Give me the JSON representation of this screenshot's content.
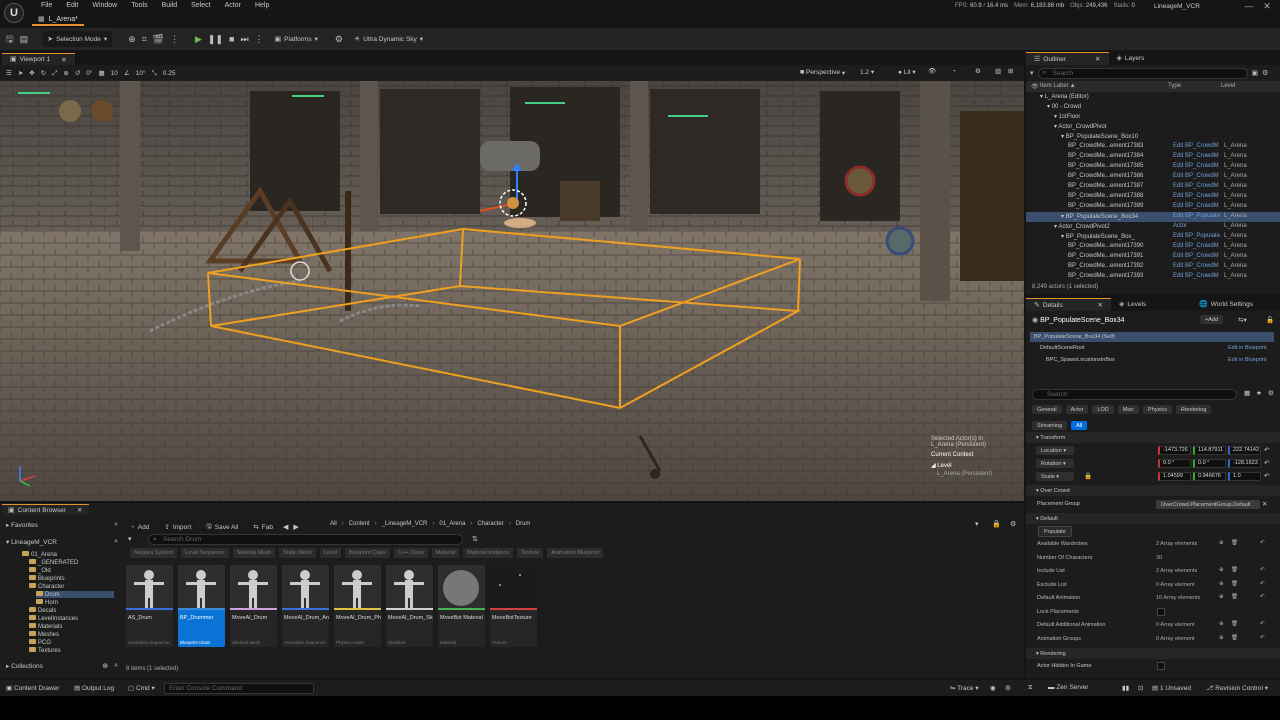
{
  "app": {
    "logo": "U",
    "doc_tab": "L_Arena*",
    "menu": [
      "File",
      "Edit",
      "Window",
      "Tools",
      "Build",
      "Select",
      "Actor",
      "Help"
    ],
    "stats": {
      "fps_label": "FPS",
      "fps": "60.9",
      "ms": "16.4 ms",
      "mem_label": "Mem",
      "mem": "6,183.88 mb",
      "objs_label": "Objs",
      "objs": "249,436",
      "stalls_label": "Stalls",
      "stalls": "0"
    },
    "project": "LineageM_VCR"
  },
  "toolbar": {
    "selection_mode": "Selection Mode",
    "platforms": "Platforms",
    "sky": "Ultra Dynamic Sky"
  },
  "viewport": {
    "tab": "Viewport 1",
    "tools": {
      "rot": "0°",
      "snap1": "10",
      "snap2": "10°",
      "scale": "0.25",
      "perspective": "Perspective",
      "speed": "1.2",
      "lit": "Lit"
    },
    "selected_label": "Selected Actor(s) in",
    "selected_level": "L_Arena (Persistent)",
    "context_label": "Current Context",
    "context_level_label": "Level",
    "context_level": "L_Arena (Persistent)"
  },
  "outliner": {
    "tabs": [
      "Outliner",
      "Layers"
    ],
    "search_placeholder": "Search",
    "columns": [
      "Item Label ▲",
      "Type",
      "Level"
    ],
    "rows": [
      {
        "label": "L_Arena (Editor)",
        "type": "",
        "level": "",
        "indent": 0
      },
      {
        "label": "00 - Crowd",
        "type": "",
        "level": "",
        "indent": 1
      },
      {
        "label": "1stFloor",
        "type": "",
        "level": "",
        "indent": 2
      },
      {
        "label": "Actor_CrowdPivot",
        "type": "",
        "level": "",
        "indent": 2
      },
      {
        "label": "BP_PopulateScene_Box10",
        "type": "",
        "level": "",
        "indent": 3
      },
      {
        "label": "BP_CrowdMe...ement17383",
        "type": "Edit BP_CrowdM",
        "level": "L_Arena",
        "indent": 4
      },
      {
        "label": "BP_CrowdMe...ement17384",
        "type": "Edit BP_CrowdM",
        "level": "L_Arena",
        "indent": 4
      },
      {
        "label": "BP_CrowdMe...ement17385",
        "type": "Edit BP_CrowdM",
        "level": "L_Arena",
        "indent": 4
      },
      {
        "label": "BP_CrowdMe...ement17386",
        "type": "Edit BP_CrowdM",
        "level": "L_Arena",
        "indent": 4
      },
      {
        "label": "BP_CrowdMe...ement17387",
        "type": "Edit BP_CrowdM",
        "level": "L_Arena",
        "indent": 4
      },
      {
        "label": "BP_CrowdMe...ement17388",
        "type": "Edit BP_CrowdM",
        "level": "L_Arena",
        "indent": 4
      },
      {
        "label": "BP_CrowdMe...ement17389",
        "type": "Edit BP_CrowdM",
        "level": "L_Arena",
        "indent": 4
      },
      {
        "label": "BP_PopulateScene_Box34",
        "type": "Edit BP_Populate",
        "level": "L_Arena",
        "indent": 3
      },
      {
        "label": "Actor_CrowdPivot2",
        "type": "Actor",
        "level": "L_Arena",
        "indent": 2
      },
      {
        "label": "BP_PopulateScene_Box_",
        "type": "Edit BP_Populate",
        "level": "L_Arena",
        "indent": 3
      },
      {
        "label": "BP_CrowdMe...ement17390",
        "type": "Edit BP_CrowdM",
        "level": "L_Arena",
        "indent": 4
      },
      {
        "label": "BP_CrowdMe...ement17391",
        "type": "Edit BP_CrowdM",
        "level": "L_Arena",
        "indent": 4
      },
      {
        "label": "BP_CrowdMe...ement17392",
        "type": "Edit BP_CrowdM",
        "level": "L_Arena",
        "indent": 4
      },
      {
        "label": "BP_CrowdMe...ement17393",
        "type": "Edit BP_CrowdM",
        "level": "L_Arena",
        "indent": 4
      }
    ],
    "footer": "8,249 actors (1 selected)"
  },
  "details": {
    "tabs": [
      "Details",
      "Levels",
      "World Settings"
    ],
    "actor_name": "BP_PopulateScene_Box34",
    "add_label": "+Add",
    "components": [
      {
        "label": "BP_PopulateScene_Box34 (Self)",
        "link": ""
      },
      {
        "label": "DefaultSceneRoot",
        "link": "Edit in Blueprint"
      },
      {
        "label": "BPC_SpawnLocationsInBox",
        "link": "Edit in Blueprint"
      }
    ],
    "search_placeholder": "Search",
    "filters": [
      "General",
      "Actor",
      "LOD",
      "Misc",
      "Physics",
      "Rendering",
      "Streaming",
      "All"
    ],
    "transform_header": "Transform",
    "location_label": "Location",
    "location": [
      "-1473.726",
      "114.87911",
      "222.74142"
    ],
    "rotation_label": "Rotation",
    "rotation": [
      "0.0 °",
      "0.0 °",
      "-128.1623"
    ],
    "scale_label": "Scale",
    "scale": [
      "1.04599",
      "0.946676",
      "1.0"
    ],
    "overcrowd_header": "Over Crowd",
    "placement_label": "Placement Group",
    "placement_value": "OverCrowd.PlacementGroup.Default",
    "default_header": "Default",
    "populate_button": "Populate",
    "props": [
      {
        "label": "Available Wardrobes",
        "value": "2 Array elements"
      },
      {
        "label": "Number Of Characters",
        "value": "30"
      },
      {
        "label": "Include List",
        "value": "2 Array elements"
      },
      {
        "label": "Exclude List",
        "value": "0 Array element"
      },
      {
        "label": "Default Animation",
        "value": "10 Array elements"
      },
      {
        "label": "Lock Placements",
        "value": ""
      },
      {
        "label": "Default Additional Animation",
        "value": "0 Array element"
      },
      {
        "label": "Animation Groups",
        "value": "0 Array element"
      }
    ],
    "rendering_header": "Rendering",
    "rendering_prop": "Actor Hidden In Game"
  },
  "content_browser": {
    "tab": "Content Browser",
    "add": "Add",
    "import": "Import",
    "save_all": "Save All",
    "fab": "Fab",
    "breadcrumb": [
      "All",
      "Content",
      "_LineageM_VCR",
      "01_Arena",
      "Character",
      "Drum"
    ],
    "search_placeholder": "Search Drum",
    "favorites": "Favorites",
    "project_root": "LineageM_VCR",
    "tree": [
      {
        "label": "01_Arena",
        "indent": 0
      },
      {
        "label": "_GENERATED",
        "indent": 1
      },
      {
        "label": "_Old",
        "indent": 1
      },
      {
        "label": "Blueprints",
        "indent": 1
      },
      {
        "label": "Character",
        "indent": 1
      },
      {
        "label": "Drum",
        "indent": 2
      },
      {
        "label": "Horn",
        "indent": 2
      },
      {
        "label": "Decals",
        "indent": 1
      },
      {
        "label": "LevelInstances",
        "indent": 1
      },
      {
        "label": "Materials",
        "indent": 1
      },
      {
        "label": "Meshes",
        "indent": 1
      },
      {
        "label": "PCG",
        "indent": 1
      },
      {
        "label": "Textures",
        "indent": 1
      }
    ],
    "collections": "Collections",
    "filter_chips": [
      "Niagara System",
      "Level Sequence",
      "Skeletal Mesh",
      "Static Mesh",
      "Level",
      "Blueprint Class",
      "C++ Class",
      "Material",
      "Material Instance",
      "Texture",
      "Animation Blueprint"
    ],
    "assets": [
      {
        "name": "AS_Drum",
        "type": "Animation Sequence",
        "color": "#3a6fd8"
      },
      {
        "name": "BP_Drummer",
        "type": "Blueprint Class",
        "color": "#3a8ad8"
      },
      {
        "name": "MoveAI_Drum",
        "type": "Skeletal Mesh",
        "color": "#d0a0e0"
      },
      {
        "name": "MoveAI_Drum_Anim",
        "type": "Animation Sequence",
        "color": "#3a6fd8"
      },
      {
        "name": "MoveAI_Drum_PhysicsAsset",
        "type": "Physics Asset",
        "color": "#e0c040"
      },
      {
        "name": "MoveAI_Drum_Skeleton",
        "type": "Skeleton",
        "color": "#d0d0d0"
      },
      {
        "name": "MoveBot Material",
        "type": "Material",
        "color": "#4caf50"
      },
      {
        "name": "MoveBotTexture",
        "type": "Texture",
        "color": "#d04040"
      }
    ],
    "footer": "8 items (1 selected)"
  },
  "statusbar": {
    "drawer": "Content Drawer",
    "output": "Output Log",
    "cmd": "Cmd",
    "console_placeholder": "Enter Console Command",
    "trace": "Trace",
    "zen": "Zen Server",
    "unsaved": "1 Unsaved",
    "revision": "Revision Control"
  },
  "colors": {
    "accent": "#e8912a",
    "selection": "#0a74d6",
    "box": "#f0a020"
  }
}
